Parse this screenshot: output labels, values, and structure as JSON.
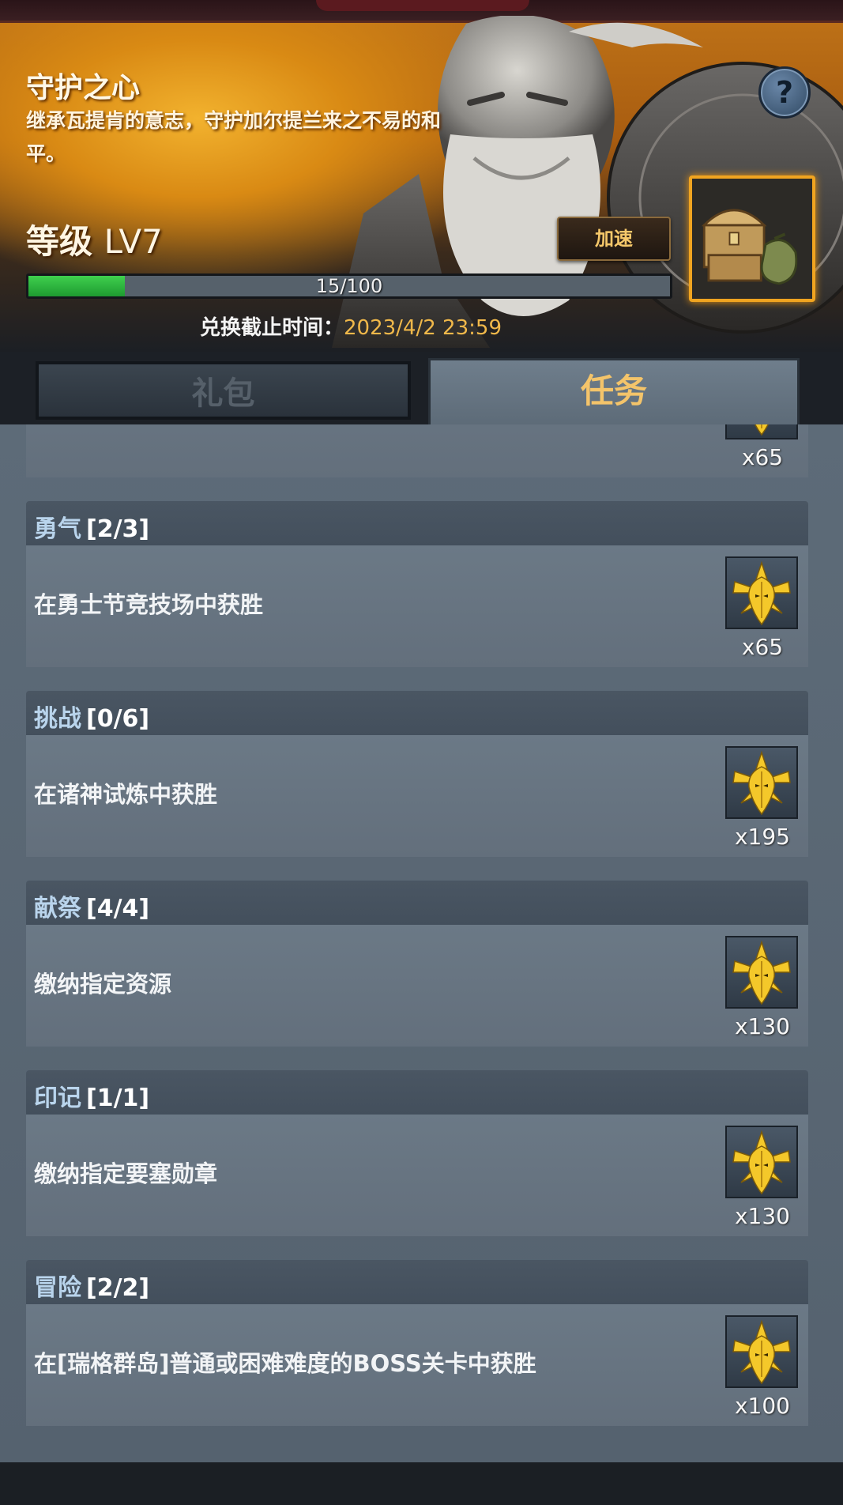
{
  "event": {
    "title": "守护之心",
    "description": "继承瓦提肯的意志，守护加尔提兰来之不易的和平。",
    "level_label": "等级",
    "level_value": "LV7",
    "speed_button": "加速",
    "progress": {
      "text": "15/100",
      "current": 15,
      "max": 100
    },
    "deadline_label": "兑换截止时间：",
    "deadline_value": "2023/4/2 23:59"
  },
  "tabs": {
    "gift": "礼包",
    "task": "任务",
    "active": "task"
  },
  "tasks": [
    {
      "name": "",
      "progress": "",
      "description": "",
      "reward": "x65"
    },
    {
      "name": "勇气",
      "progress": "[2/3]",
      "description": "在勇士节竞技场中获胜",
      "reward": "x65"
    },
    {
      "name": "挑战",
      "progress": "[0/6]",
      "description": "在诸神试炼中获胜",
      "reward": "x195"
    },
    {
      "name": "献祭",
      "progress": "[4/4]",
      "description": "缴纳指定资源",
      "reward": "x130"
    },
    {
      "name": "印记",
      "progress": "[1/1]",
      "description": "缴纳指定要塞勋章",
      "reward": "x130"
    },
    {
      "name": "冒险",
      "progress": "[2/2]",
      "description": "在[瑞格群岛]普通或困难难度的BOSS关卡中获胜",
      "reward": "x100"
    }
  ],
  "icons": {
    "help": "question-mark-icon",
    "chest": "treasure-chest-icon",
    "reward": "golden-emblem-icon"
  }
}
